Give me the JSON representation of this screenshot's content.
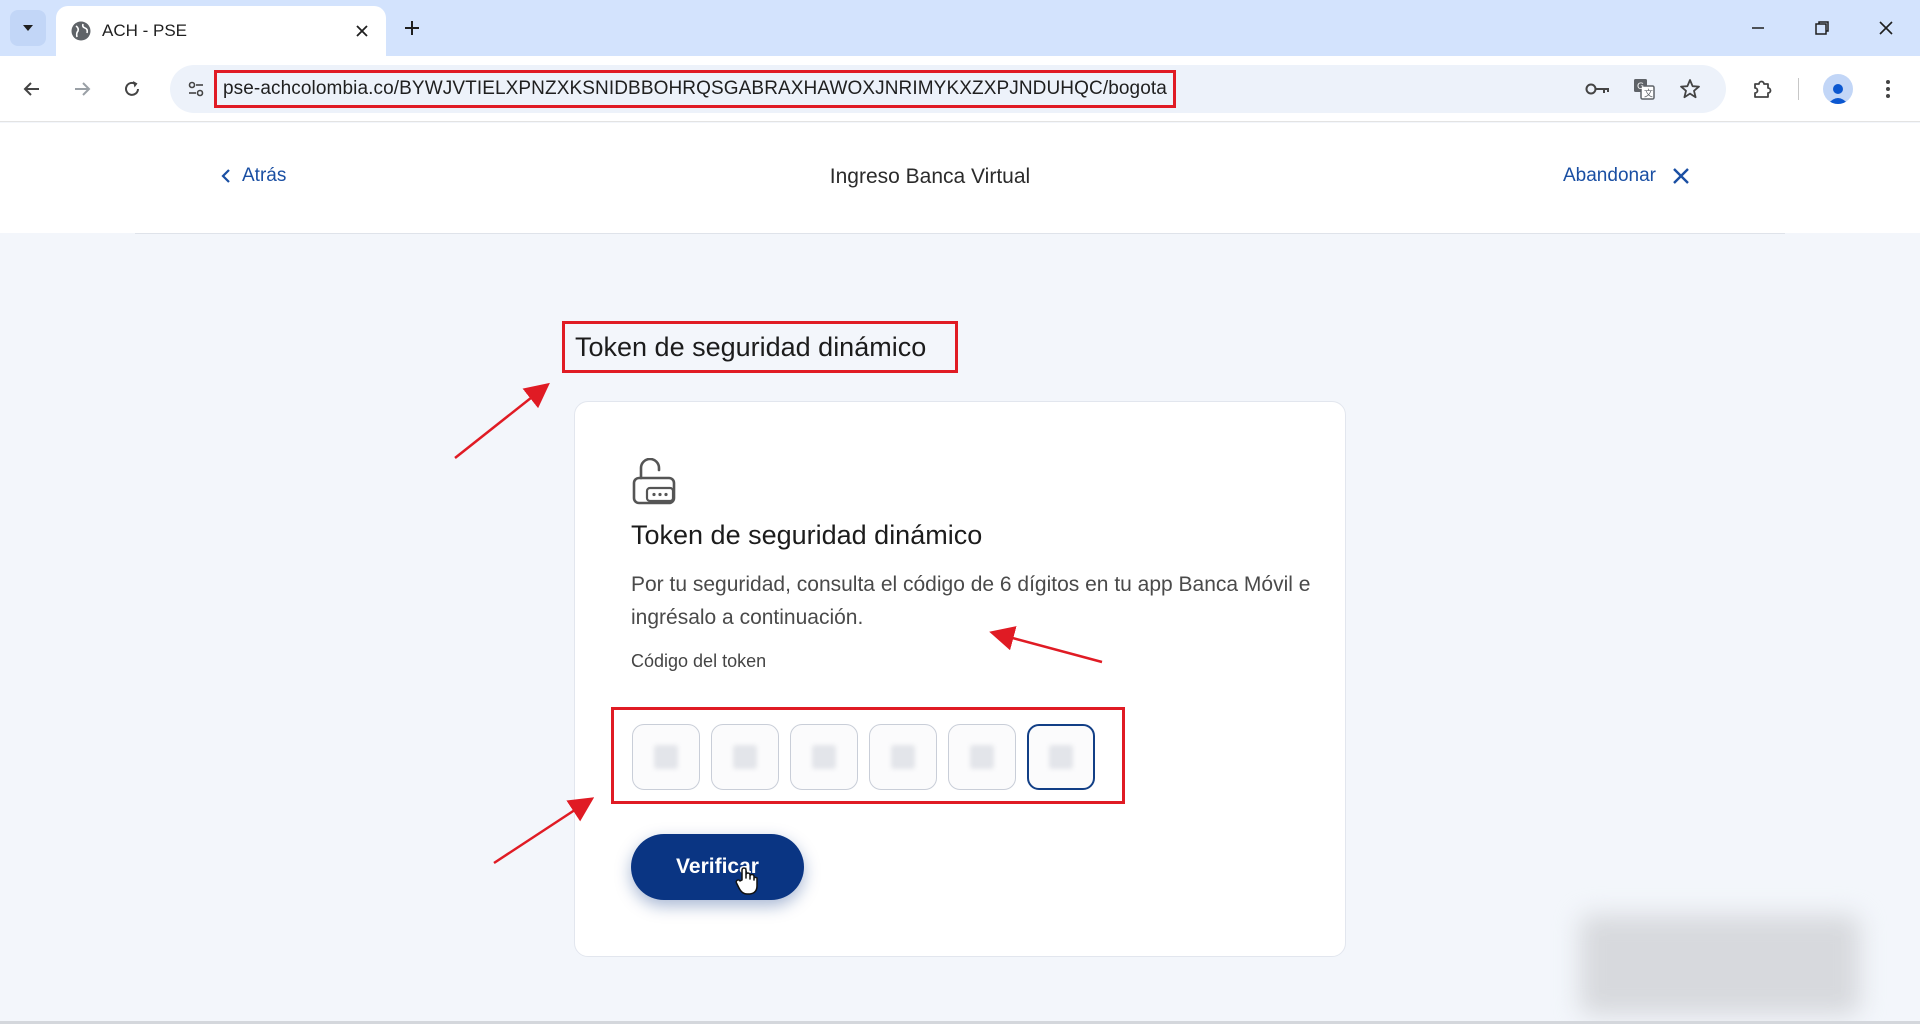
{
  "browser": {
    "tab_title": "ACH - PSE",
    "url": "pse-achcolombia.co/BYWJVTIELXPNZXKSNIDBBOHRQSGABRAXHAWOXJNRIMYKXZXPJNDUHQC/bogota",
    "icons": {
      "tab_search": "chevron-down-icon",
      "favicon": "globe-icon",
      "tab_close": "close-icon",
      "new_tab": "plus-icon",
      "minimize": "minimize-icon",
      "restore": "restore-icon",
      "close_window": "close-icon",
      "back": "arrow-left-icon",
      "forward": "arrow-right-icon",
      "reload": "reload-icon",
      "site_info": "tune-icon",
      "password": "key-icon",
      "translate": "translate-icon",
      "bookmark": "star-icon",
      "extensions": "puzzle-icon",
      "profile": "avatar-icon",
      "menu": "kebab-menu-icon"
    }
  },
  "header": {
    "back_label": "Atrás",
    "title": "Ingreso Banca Virtual",
    "abandon_label": "Abandonar"
  },
  "main": {
    "outer_title": "Token de seguridad dinámico",
    "card": {
      "icon": "lock-open-icon",
      "title": "Token de seguridad dinámico",
      "description": "Por tu seguridad, consulta el código de 6 dígitos en tu app Banca Móvil e ingrésalo a continuación.",
      "token_label": "Código del token",
      "digit_count": 6,
      "verify_label": "Verificar"
    }
  },
  "colors": {
    "accent": "#0a3583",
    "link": "#1a4fa3",
    "highlight_annotation": "#e01b24"
  }
}
